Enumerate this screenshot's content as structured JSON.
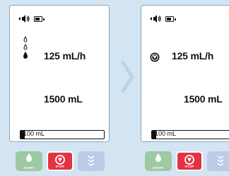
{
  "panels": [
    {
      "rate": "125 mL/h",
      "volume": "1500 mL",
      "progress": {
        "text": "100 mL",
        "fill_fraction": 0.06
      },
      "status_icon": "drip-drops-icon",
      "buttons": {
        "start": "START",
        "stop": "STOP",
        "menu": ""
      }
    },
    {
      "rate": "125 mL/h",
      "volume": "1500 mL",
      "progress": {
        "text": "100 mL",
        "fill_fraction": 0.06
      },
      "status_icon": "stop-indicator-icon",
      "buttons": {
        "start": "START",
        "stop": "STOP",
        "menu": ""
      }
    }
  ],
  "colors": {
    "background": "#d3e5f2",
    "start_button": "#9ec9a2",
    "stop_button": "#e23343",
    "menu_button": "#bccbe6"
  }
}
